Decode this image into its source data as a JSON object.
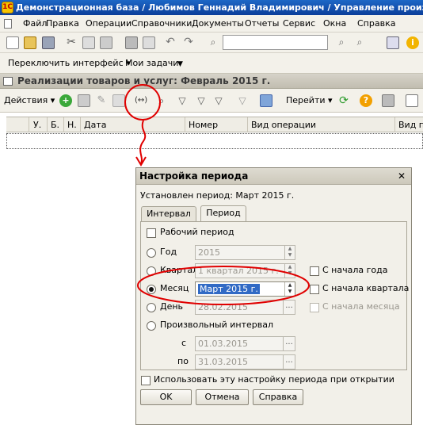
{
  "window": {
    "title": "Демонстрационная база / Любимов Геннадий Владимирович / Управление производств"
  },
  "menu": [
    "Файл",
    "Правка",
    "Операции",
    "Справочники",
    "Документы",
    "Отчеты",
    "Сервис",
    "Окна",
    "Справка"
  ],
  "toolbar2": {
    "switch_interface": "Переключить интерфейс ▾",
    "my_tasks": "Мои задачи"
  },
  "doc_window": {
    "title": "Реализации товаров и услуг: Февраль 2015 г."
  },
  "toolbar3": {
    "actions": "Действия ▾",
    "goto": "Перейти ▾"
  },
  "grid": {
    "columns": [
      "У.",
      "Б.",
      "Н.",
      "Дата",
      "Номер",
      "Вид операции",
      "Вид пе"
    ]
  },
  "dialog": {
    "title": "Настройка периода",
    "close": "✕",
    "current_period": "Установлен период: Март 2015 г.",
    "tabs": [
      "Интервал",
      "Период"
    ],
    "working_period": "Рабочий период",
    "year_label": "Год",
    "year_value": "2015",
    "quarter_label": "Квартал",
    "quarter_value": "1 квартал 2015 г.",
    "from_year_start": "С начала года",
    "month_label": "Месяц",
    "month_value": "Март 2015 г.",
    "from_quarter_start": "С начала квартала",
    "day_label": "День",
    "day_value": "28.02.2015",
    "from_month_start": "С начала месяца",
    "arbitrary_interval": "Произвольный интервал",
    "from_label": "с",
    "from_value": "01.03.2015",
    "to_label": "по",
    "to_value": "31.03.2015",
    "use_on_open": "Использовать эту настройку периода при открытии",
    "ok": "OK",
    "cancel": "Отмена",
    "help": "Справка"
  },
  "colors": {
    "titlebar": "#1d67c6",
    "annotation": "#e00000"
  }
}
